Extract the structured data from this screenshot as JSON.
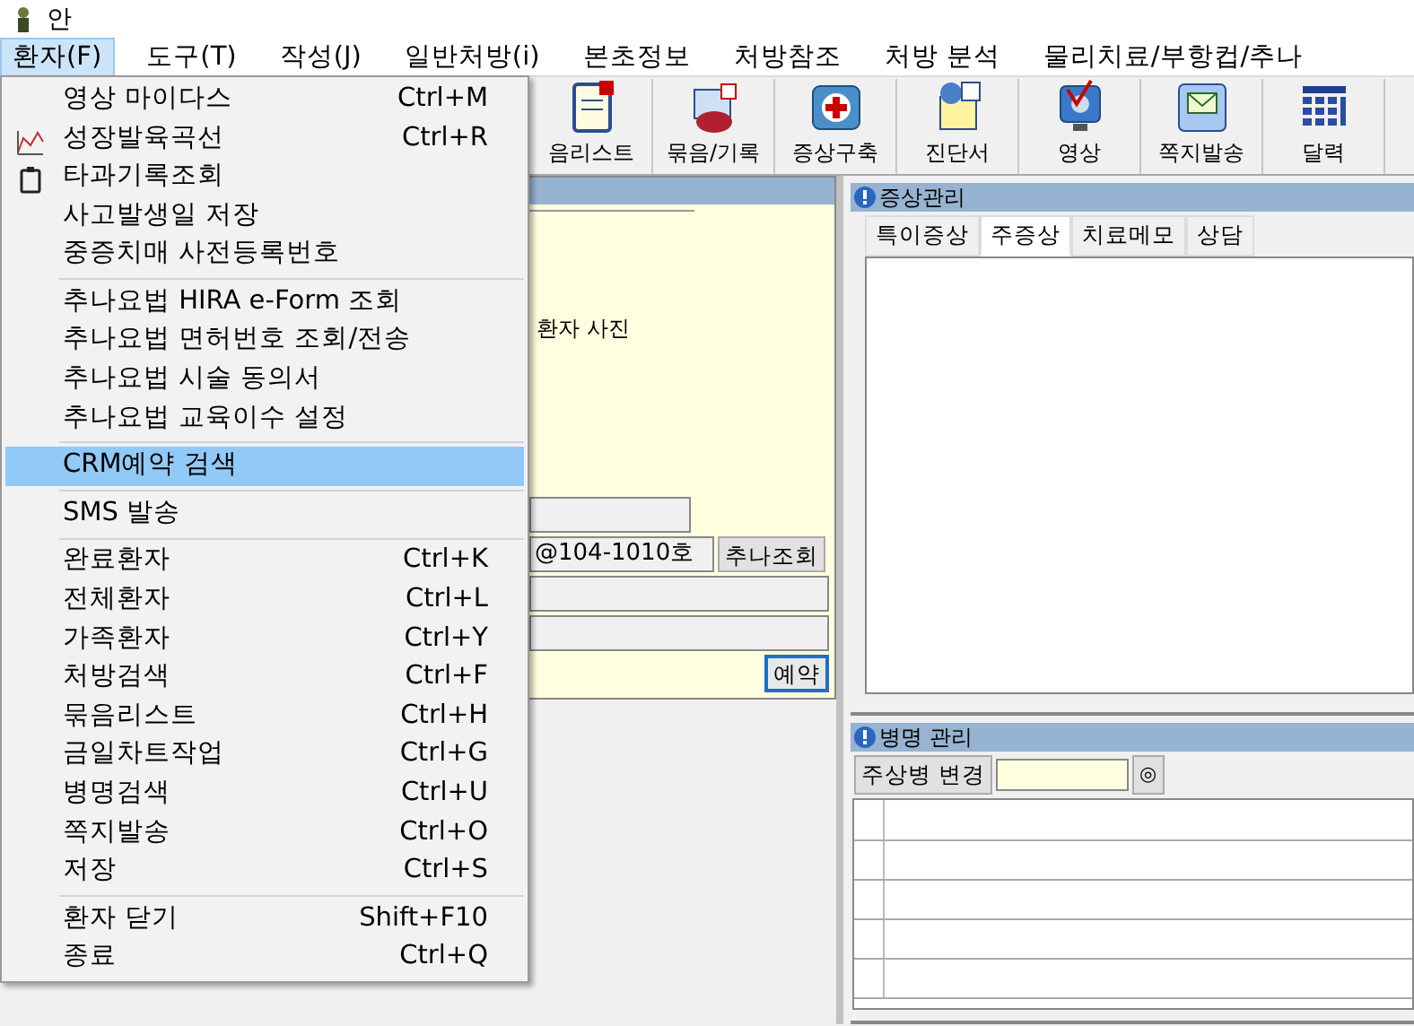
{
  "window": {
    "title": "안"
  },
  "menubar": [
    {
      "label": "환자(F)",
      "selected": true
    },
    {
      "label": "도구(T)",
      "selected": false
    },
    {
      "label": "작성(J)",
      "selected": false
    },
    {
      "label": "일반처방(i)",
      "selected": false
    },
    {
      "label": "본초정보",
      "selected": false
    },
    {
      "label": "처방참조",
      "selected": false
    },
    {
      "label": "처방 분석",
      "selected": false
    },
    {
      "label": "물리치료/부항컵/추나",
      "selected": false
    }
  ],
  "toolbar": [
    {
      "label": "음리스트",
      "kind": "document"
    },
    {
      "label": "묶음/기록",
      "kind": "bag"
    },
    {
      "label": "증상구축",
      "kind": "kit"
    },
    {
      "label": "진단서",
      "kind": "certificate"
    },
    {
      "label": "영상",
      "kind": "monitor"
    },
    {
      "label": "쪽지발송",
      "kind": "envelope"
    },
    {
      "label": "달력",
      "kind": "calendar"
    }
  ],
  "menu": [
    {
      "kind": "item",
      "label": "영상 마이다스",
      "shortcut": "Ctrl+M",
      "selected": false
    },
    {
      "kind": "chart",
      "label": "성장발육곡선",
      "shortcut": "Ctrl+R",
      "selected": false
    },
    {
      "kind": "clipboard",
      "label": "타과기록조회",
      "selected": false
    },
    {
      "kind": "item",
      "label": "사고발생일 저장",
      "selected": false
    },
    {
      "kind": "item",
      "label": "중증치매 사전등록번호",
      "selected": false
    },
    {
      "kind": "separator"
    },
    {
      "kind": "item",
      "label": "추나요법 HIRA e-Form 조회",
      "selected": false
    },
    {
      "kind": "item",
      "label": "추나요법 면허번호 조회/전송",
      "selected": false
    },
    {
      "kind": "item",
      "label": "추나요법 시술 동의서",
      "selected": false
    },
    {
      "kind": "item",
      "label": "추나요법 교육이수 설정",
      "selected": false
    },
    {
      "kind": "separator"
    },
    {
      "kind": "item",
      "label": "CRM예약 검색",
      "selected": true
    },
    {
      "kind": "separator"
    },
    {
      "kind": "item",
      "label": "SMS 발송",
      "selected": false
    },
    {
      "kind": "separator"
    },
    {
      "kind": "item",
      "label": "완료환자",
      "shortcut": "Ctrl+K",
      "selected": false
    },
    {
      "kind": "item",
      "label": "전체환자",
      "shortcut": "Ctrl+L",
      "selected": false
    },
    {
      "kind": "item",
      "label": "가족환자",
      "shortcut": "Ctrl+Y",
      "selected": false
    },
    {
      "kind": "item",
      "label": "처방검색",
      "shortcut": "Ctrl+F",
      "selected": false
    },
    {
      "kind": "item",
      "label": "묶음리스트",
      "shortcut": "Ctrl+H",
      "selected": false
    },
    {
      "kind": "item",
      "label": "금일차트작업",
      "shortcut": "Ctrl+G",
      "selected": false
    },
    {
      "kind": "item",
      "label": "병명검색",
      "shortcut": "Ctrl+U",
      "selected": false
    },
    {
      "kind": "item",
      "label": "쪽지발송",
      "shortcut": "Ctrl+O",
      "selected": false
    },
    {
      "kind": "item",
      "label": "저장",
      "shortcut": "Ctrl+S",
      "selected": false
    },
    {
      "kind": "separator"
    },
    {
      "kind": "item",
      "label": "환자 닫기",
      "shortcut": "Shift+F10",
      "selected": false
    },
    {
      "kind": "item",
      "label": "종료",
      "shortcut": "Ctrl+Q",
      "selected": false
    }
  ],
  "patient_panel": {
    "photo_label": "환자 사진",
    "address": "@104-1010호",
    "chuna_button": "추나조회",
    "reserve_button": "예약"
  },
  "symptom_panel": {
    "title": "증상관리",
    "tabs": [
      {
        "label": "특이증상",
        "selected": false
      },
      {
        "label": "주증상",
        "selected": true
      },
      {
        "label": "치료메모",
        "selected": false
      },
      {
        "label": "상담",
        "selected": false
      }
    ]
  },
  "disease_panel": {
    "title": "병명 관리",
    "change_button": "주상병 변경",
    "target_button": "◎"
  }
}
